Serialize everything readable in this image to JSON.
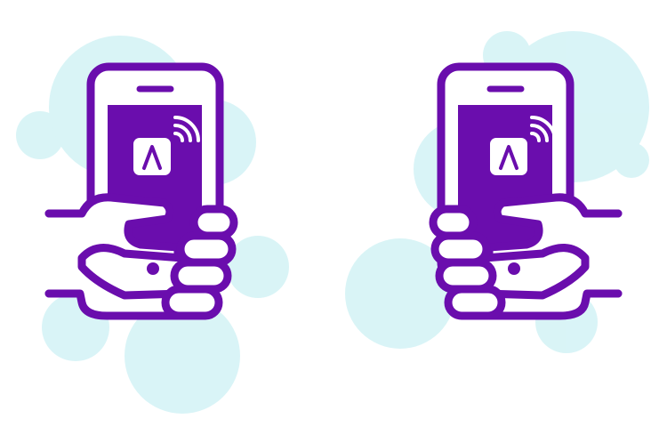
{
  "colors": {
    "primary": "#6a0dad",
    "bubble": "#c9f0f3",
    "background": "#ffffff",
    "screen_icon_bg": "#ffffff"
  },
  "illustrations": [
    {
      "name": "hand-holding-phone-left",
      "hand_side": "right",
      "icons": [
        "phone-icon",
        "app-logo-icon",
        "wireless-signal-icon",
        "hand-icon"
      ]
    },
    {
      "name": "hand-holding-phone-right",
      "hand_side": "left",
      "icons": [
        "phone-icon",
        "app-logo-icon",
        "wireless-signal-icon",
        "hand-icon"
      ]
    }
  ]
}
